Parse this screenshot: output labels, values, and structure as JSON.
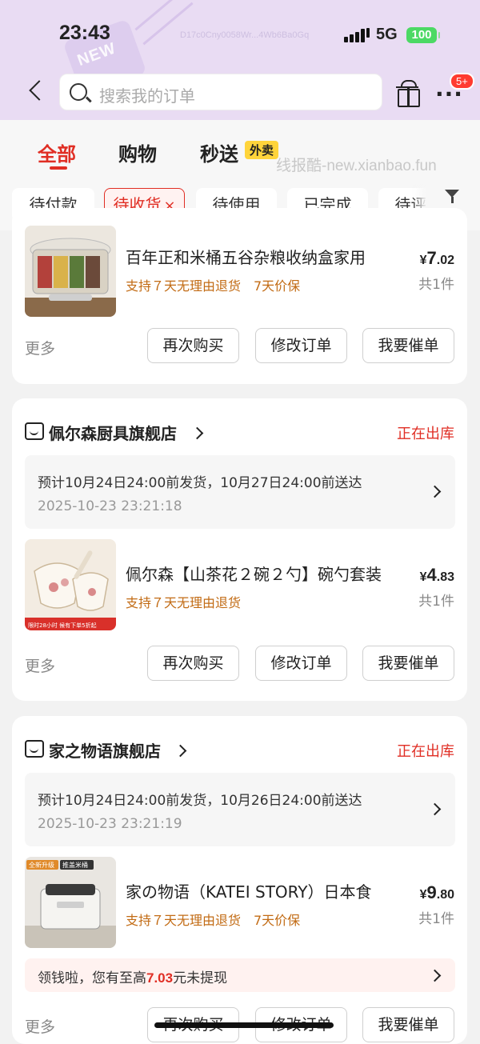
{
  "status_bar": {
    "time": "23:43",
    "network": "5G",
    "battery": "100",
    "faint_id": "D17c0Cny0058Wr...4Wb6Ba0Gq"
  },
  "header": {
    "search_placeholder": "搜索我的订单",
    "badge": "5+",
    "deco_text": "NEW"
  },
  "tabs": [
    {
      "label": "全部"
    },
    {
      "label": "购物"
    },
    {
      "label": "秒送"
    }
  ],
  "tab_badge": "外卖",
  "watermark": "线报酷-new.xianbao.fun",
  "filters": [
    {
      "label": "待付款"
    },
    {
      "label": "待收货"
    },
    {
      "label": "待使用"
    },
    {
      "label": "已完成"
    },
    {
      "label": "待评价"
    }
  ],
  "filter_close": "×",
  "filter_button": "筛选",
  "chev": "›",
  "orders": [
    {
      "product_title": "百年正和米桶五谷杂粮收纳盒家用",
      "tags": "支持７天无理由退货　7天价保",
      "price_cur": "¥",
      "price_int": "7",
      "price_dec": ".02",
      "qty": "共1件",
      "more": "更多",
      "buttons": [
        "再次购买",
        "修改订单",
        "我要催单"
      ]
    },
    {
      "store": "佩尔森厨具旗舰店",
      "status": "正在出库",
      "delivery_line": "预计10月24日24:00前发货，10月27日24:00前送达",
      "delivery_time": "2025-10-23 23:21:18",
      "product_title": "佩尔森【山茶花２碗２勺】碗勺套装",
      "tags": "支持７天无理由退货",
      "thumb_text": "限时28小时 候有下单5折起",
      "price_cur": "¥",
      "price_int": "4",
      "price_dec": ".83",
      "qty": "共1件",
      "more": "更多",
      "buttons": [
        "再次购买",
        "修改订单",
        "我要催单"
      ]
    },
    {
      "store": "家之物语旗舰店",
      "status": "正在出库",
      "delivery_line": "预计10月24日24:00前发货，10月26日24:00前送达",
      "delivery_time": "2025-10-23 23:21:19",
      "product_title": "家の物语（KATEI STORY）日本食",
      "tags": "支持７天无理由退货　7天价保",
      "thumb_tag1": "全新升级",
      "thumb_tag2": "推盖米桶",
      "price_cur": "¥",
      "price_int": "9",
      "price_dec": ".80",
      "qty": "共1件",
      "promo_prefix": "领钱啦，您有至高",
      "promo_amount": "7.03",
      "promo_suffix": "元未提现",
      "more": "更多",
      "buttons": [
        "再次购买",
        "修改订单",
        "我要催单"
      ]
    }
  ]
}
